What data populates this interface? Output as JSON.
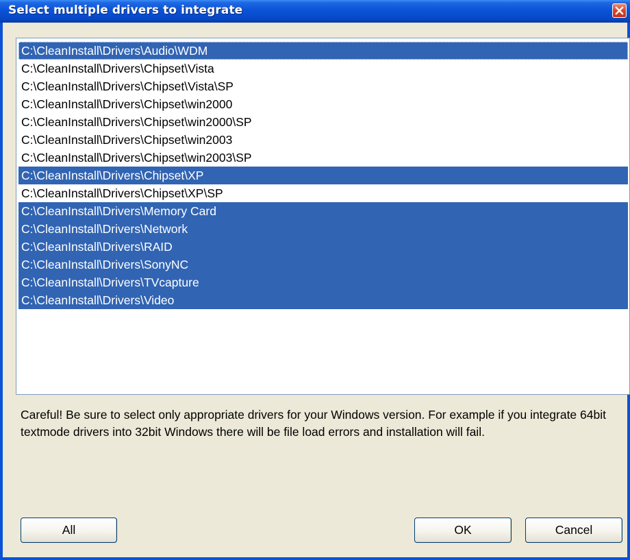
{
  "window": {
    "title": "Select multiple drivers to integrate"
  },
  "icons": {
    "close": "close-icon"
  },
  "colors": {
    "titlebar": "#0a53d8",
    "selection": "#3164b3",
    "dialog_bg": "#ece9d8"
  },
  "drivers": [
    {
      "path": "C:\\CleanInstall\\Drivers\\Audio\\WDM",
      "selected": true
    },
    {
      "path": "C:\\CleanInstall\\Drivers\\Chipset\\Vista",
      "selected": false
    },
    {
      "path": "C:\\CleanInstall\\Drivers\\Chipset\\Vista\\SP",
      "selected": false
    },
    {
      "path": "C:\\CleanInstall\\Drivers\\Chipset\\win2000",
      "selected": false
    },
    {
      "path": "C:\\CleanInstall\\Drivers\\Chipset\\win2000\\SP",
      "selected": false
    },
    {
      "path": "C:\\CleanInstall\\Drivers\\Chipset\\win2003",
      "selected": false
    },
    {
      "path": "C:\\CleanInstall\\Drivers\\Chipset\\win2003\\SP",
      "selected": false
    },
    {
      "path": "C:\\CleanInstall\\Drivers\\Chipset\\XP",
      "selected": true
    },
    {
      "path": "C:\\CleanInstall\\Drivers\\Chipset\\XP\\SP",
      "selected": false
    },
    {
      "path": "C:\\CleanInstall\\Drivers\\Memory Card",
      "selected": true
    },
    {
      "path": "C:\\CleanInstall\\Drivers\\Network",
      "selected": true
    },
    {
      "path": "C:\\CleanInstall\\Drivers\\RAID",
      "selected": true
    },
    {
      "path": "C:\\CleanInstall\\Drivers\\SonyNC",
      "selected": true
    },
    {
      "path": "C:\\CleanInstall\\Drivers\\TVcapture",
      "selected": true
    },
    {
      "path": "C:\\CleanInstall\\Drivers\\Video",
      "selected": true
    }
  ],
  "warning_text": "Careful! Be sure to select only appropriate drivers for your Windows version. For example if you integrate 64bit textmode drivers into 32bit Windows there will be file load errors and installation will fail.",
  "buttons": {
    "all": "All",
    "ok": "OK",
    "cancel": "Cancel"
  }
}
